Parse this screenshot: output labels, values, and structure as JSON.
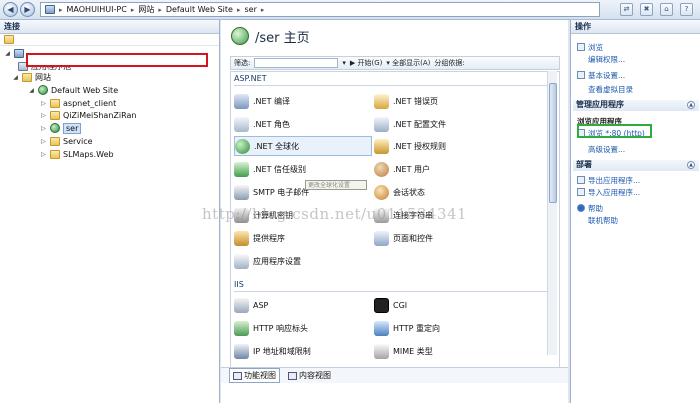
{
  "breadcrumb": [
    "MAOHUIHUI-PC",
    "网站",
    "Default Web Site",
    "ser"
  ],
  "left": {
    "header": "连接",
    "tree": [
      {
        "label": "",
        "kind": "server",
        "expand": "◢"
      },
      {
        "label": "应用程序池",
        "kind": "pool",
        "expand": ""
      },
      {
        "label": "网站",
        "kind": "folder",
        "expand": "◢"
      },
      {
        "label": "Default Web Site",
        "kind": "globe",
        "expand": "◢"
      },
      {
        "label": "aspnet_client",
        "kind": "folder",
        "expand": "▷"
      },
      {
        "label": "QiZiMeiShanZiRan",
        "kind": "folder",
        "expand": "▷"
      },
      {
        "label": "ser",
        "kind": "globe",
        "expand": "▷"
      },
      {
        "label": "Service",
        "kind": "folder",
        "expand": "▷"
      },
      {
        "label": "SLMaps.Web",
        "kind": "folder",
        "expand": "▷"
      }
    ]
  },
  "center": {
    "title": "/ser 主页",
    "filter_label": "筛选:",
    "filter_start": "开始(G)",
    "filter_showall": "全部显示(A)",
    "filter_group": "分组依据:",
    "group_aspnet": "ASP.NET",
    "group_iis": "IIS",
    "features_aspnet": [
      ".NET 编译",
      ".NET 错误页",
      ".NET 角色",
      ".NET 配置文件",
      ".NET 全球化",
      ".NET 授权规则",
      ".NET 信任级别",
      ".NET 用户",
      "SMTP 电子邮件",
      "会话状态",
      "计算机密钥",
      "连接字符串",
      "提供程序",
      "页面和控件",
      "应用程序设置"
    ],
    "features_iis": [
      "ASP",
      "CGI",
      "HTTP 响应标头",
      "HTTP 重定向",
      "IP 地址和域限制",
      "MIME 类型"
    ],
    "tooltip": "更改全球化设置",
    "tab_features": "功能视图",
    "tab_content": "内容视图",
    "watermark": "http://blog.csdn.net/u011534341"
  },
  "right": {
    "header": "操作",
    "explore": "浏览",
    "edit_perms": "编辑权限...",
    "basic_settings": "基本设置...",
    "view_virtual_dirs": "查看虚拟目录",
    "manage_app": "管理应用程序",
    "browse_app": "浏览应用程序",
    "browse_http": "浏览 *:80 (http)",
    "advanced_settings": "高级设置...",
    "deploy": "部署",
    "export_app": "导出应用程序...",
    "import_app": "导入应用程序...",
    "help": "帮助",
    "online_help": "联机帮助"
  },
  "colors": {
    "redact": "#d6131c",
    "highlight": "#2eaa3f",
    "link": "#1d58b0"
  }
}
